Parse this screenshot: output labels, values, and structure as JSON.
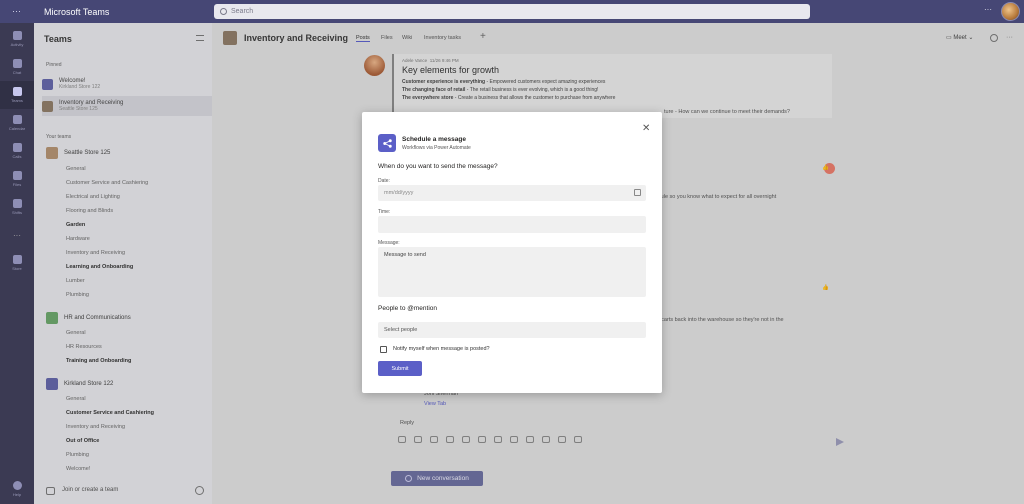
{
  "app": {
    "title": "Microsoft Teams",
    "search_placeholder": "Search"
  },
  "rail": [
    {
      "label": "Activity",
      "icon": "bell-icon"
    },
    {
      "label": "Chat",
      "icon": "chat-icon"
    },
    {
      "label": "Teams",
      "icon": "teams-icon",
      "active": true
    },
    {
      "label": "Calendar",
      "icon": "calendar-icon"
    },
    {
      "label": "Calls",
      "icon": "phone-icon"
    },
    {
      "label": "Files",
      "icon": "file-icon"
    },
    {
      "label": "Shifts",
      "icon": "clock-icon"
    },
    {
      "label": "Store",
      "icon": "store-icon"
    },
    {
      "label": "Help",
      "icon": "help-icon"
    }
  ],
  "left": {
    "title": "Teams",
    "pinned_label": "Pinned",
    "pinned": [
      {
        "name": "Welcome!",
        "sub": "Kirkland Store 122"
      },
      {
        "name": "Inventory and Receiving",
        "sub": "Seattle Store 125"
      }
    ],
    "your_teams_label": "Your teams",
    "teams": [
      {
        "name": "Seattle Store 125",
        "channels": [
          {
            "name": "General",
            "bold": false
          },
          {
            "name": "Customer Service and Cashiering",
            "bold": false
          },
          {
            "name": "Electrical and Lighting",
            "bold": false
          },
          {
            "name": "Flooring and Blinds",
            "bold": false
          },
          {
            "name": "Garden",
            "bold": true
          },
          {
            "name": "Hardware",
            "bold": false
          },
          {
            "name": "Inventory and Receiving",
            "bold": false
          },
          {
            "name": "Learning and Onboarding",
            "bold": true
          },
          {
            "name": "Lumber",
            "bold": false
          },
          {
            "name": "Plumbing",
            "bold": false
          }
        ]
      },
      {
        "name": "HR and Communications",
        "channels": [
          {
            "name": "General",
            "bold": false
          },
          {
            "name": "HR Resources",
            "bold": false
          },
          {
            "name": "Training and Onboarding",
            "bold": true
          }
        ]
      },
      {
        "name": "Kirkland Store 122",
        "channels": [
          {
            "name": "General",
            "bold": false
          },
          {
            "name": "Customer Service and Cashiering",
            "bold": true
          },
          {
            "name": "Inventory and Receiving",
            "bold": false
          },
          {
            "name": "Out of Office",
            "bold": true
          },
          {
            "name": "Plumbing",
            "bold": false
          },
          {
            "name": "Welcome!",
            "bold": false
          }
        ]
      }
    ],
    "join_label": "Join or create a team"
  },
  "channel": {
    "name": "Inventory and Receiving",
    "tabs": [
      "Posts",
      "Files",
      "Wiki",
      "Inventory tasks"
    ],
    "meet_label": "Meet"
  },
  "post": {
    "author": "Adele Vance",
    "time": "11/26 9:46 PM",
    "title": "Key elements for growth",
    "lines": [
      {
        "bold": "Customer experience is everything",
        "rest": " - Empowered customers expect amazing experiences"
      },
      {
        "bold": "The changing face of retail",
        "rest": " - The retail business is ever evolving, which is a good thing!"
      },
      {
        "bold": "The everywhere store",
        "rest": " - Create a business that allows the customer to purchase from anywhere"
      }
    ],
    "reply_frag_1": "ture - How can we continue to meet their demands?",
    "reply_frag_2": "schedule so you know what to expect for all overnight",
    "reply_frag_3": "the carts back into the warehouse so they're not in the",
    "reply_name": "Joni Sherman",
    "reply_sub": "View Tab",
    "reply_label": "Reply",
    "new_conversation": "New conversation"
  },
  "dialog": {
    "title": "Schedule a message",
    "subtitle": "Workflows via Power Automate",
    "question": "When do you want to send the message?",
    "date_label": "Date:",
    "date_placeholder": "mm/dd/yyyy",
    "time_label": "Time:",
    "message_label": "Message:",
    "message_value": "Message to send",
    "people_label": "People to @mention",
    "people_placeholder": "Select people",
    "notify_label": "Notify myself when message is posted?",
    "submit_label": "Submit"
  },
  "colors": {
    "accent": "#5b5fc7",
    "titlebar": "#464775",
    "rail": "#3b3a53"
  }
}
